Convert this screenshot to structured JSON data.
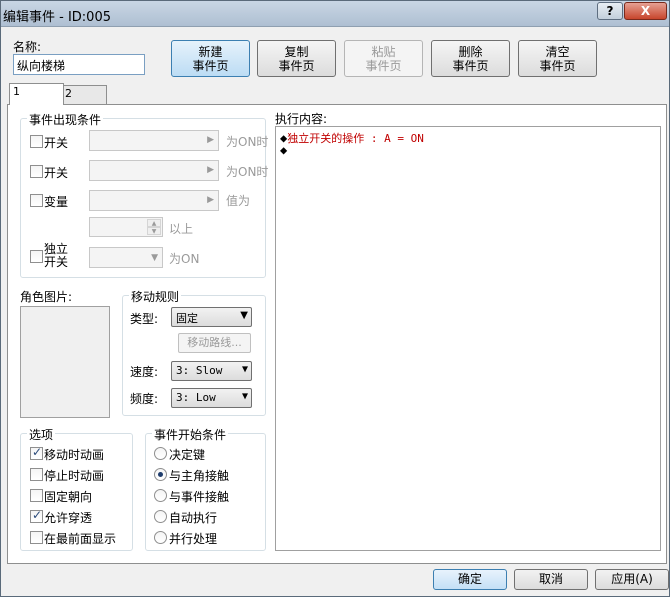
{
  "window": {
    "title": "编辑事件 - ID:005",
    "help_label": "?",
    "close_label": "X"
  },
  "name": {
    "label": "名称:",
    "value": "纵向楼梯"
  },
  "toolbar": [
    {
      "line1": "新建",
      "line2": "事件页",
      "state": "primary"
    },
    {
      "line1": "复制",
      "line2": "事件页",
      "state": "normal"
    },
    {
      "line1": "粘贴",
      "line2": "事件页",
      "state": "disabled"
    },
    {
      "line1": "删除",
      "line2": "事件页",
      "state": "normal"
    },
    {
      "line1": "清空",
      "line2": "事件页",
      "state": "normal"
    }
  ],
  "tabs": [
    "1",
    "2"
  ],
  "conditions": {
    "title": "事件出现条件",
    "switch1_label": "开关",
    "switch1_suffix": "为ON时",
    "switch2_label": "开关",
    "switch2_suffix": "为ON时",
    "variable_label": "变量",
    "variable_suffix": "值为",
    "above_label": "以上",
    "self_switch_line1": "独立",
    "self_switch_line2": "开关",
    "self_switch_suffix": "为ON"
  },
  "graphic": {
    "title": "角色图片:"
  },
  "movement": {
    "title": "移动规则",
    "type_label": "类型:",
    "type_value": "固定",
    "route_button": "移动路线...",
    "speed_label": "速度:",
    "speed_value": "3: Slow",
    "freq_label": "频度:",
    "freq_value": "3: Low"
  },
  "options": {
    "title": "选项",
    "items": [
      {
        "label": "移动时动画",
        "checked": true
      },
      {
        "label": "停止时动画",
        "checked": false
      },
      {
        "label": "固定朝向",
        "checked": false
      },
      {
        "label": "允许穿透",
        "checked": true
      },
      {
        "label": "在最前面显示",
        "checked": false
      }
    ]
  },
  "trigger": {
    "title": "事件开始条件",
    "items": [
      {
        "label": "决定键",
        "checked": false
      },
      {
        "label": "与主角接触",
        "checked": true
      },
      {
        "label": "与事件接触",
        "checked": false
      },
      {
        "label": "自动执行",
        "checked": false
      },
      {
        "label": "并行处理",
        "checked": false
      }
    ]
  },
  "contents": {
    "title": "执行内容:",
    "lines": [
      {
        "marker": "◆",
        "text": "独立开关的操作 : A = ON"
      },
      {
        "marker": "◆",
        "text": ""
      }
    ]
  },
  "footer": {
    "ok": "确定",
    "cancel": "取消",
    "apply": "应用(A)"
  }
}
